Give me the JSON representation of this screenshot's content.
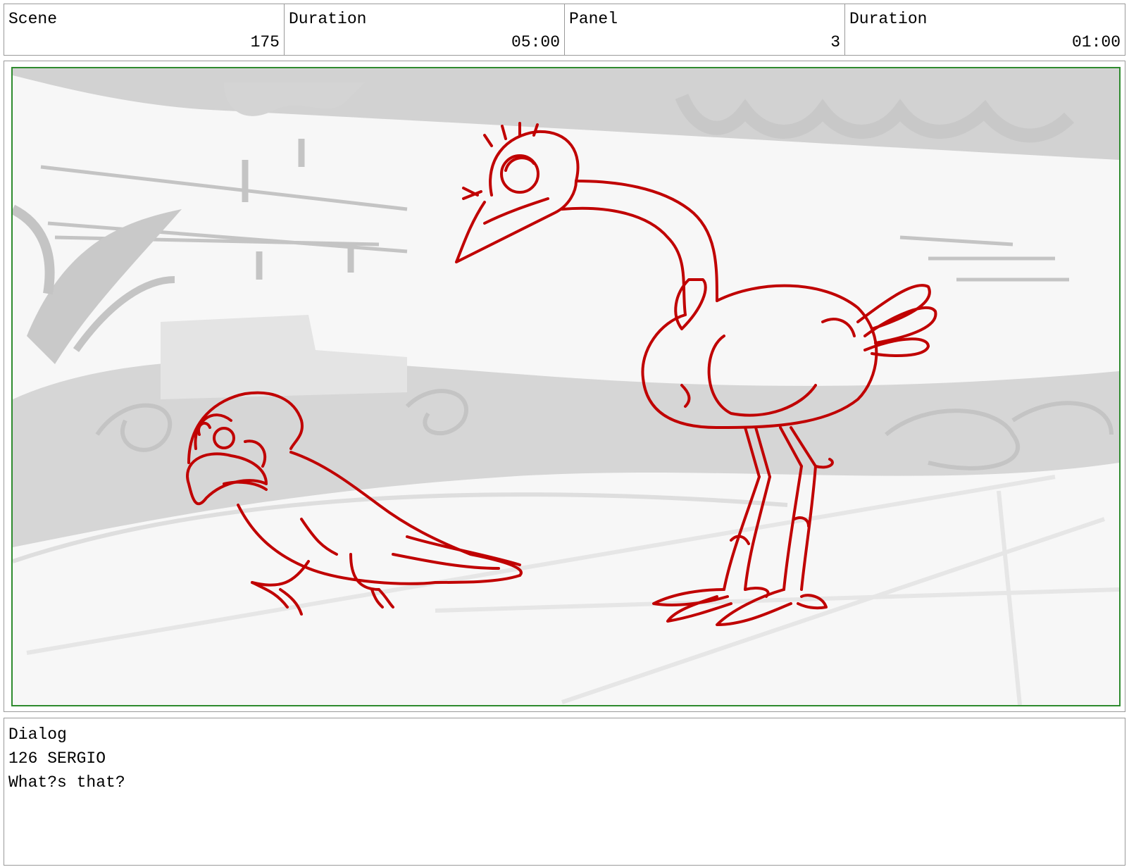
{
  "header": {
    "scene_label": "Scene",
    "scene_value": "175",
    "scene_duration_label": "Duration",
    "scene_duration_value": "05:00",
    "panel_label": "Panel",
    "panel_value": "3",
    "panel_duration_label": "Duration",
    "panel_duration_value": "01:00"
  },
  "panel_image": {
    "line_color": "#c00000",
    "background_tone": "#cccccc",
    "border_color": "#2e8b2e"
  },
  "dialog": {
    "label": "Dialog",
    "line1": "126 SERGIO",
    "line2": "What?s that?"
  }
}
